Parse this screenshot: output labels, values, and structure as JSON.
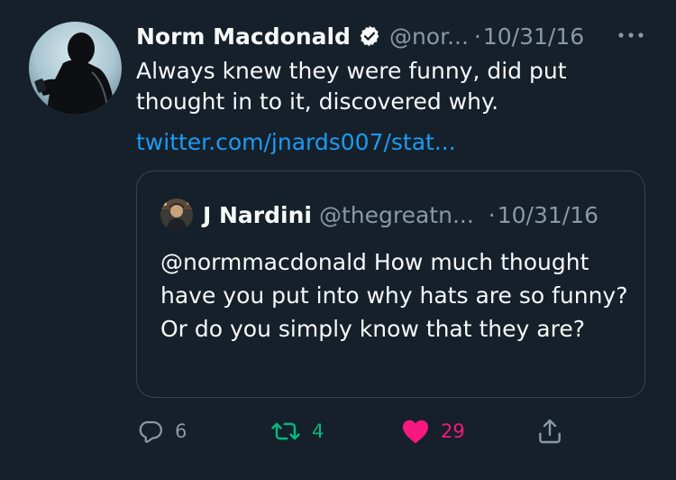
{
  "colors": {
    "background": "#15202b",
    "text": "#f7f9f9",
    "secondary": "#8b98a5",
    "link": "#1d9bf0",
    "retweet_active": "#00ba7c",
    "like_active": "#f91880",
    "border": "#38444d"
  },
  "tweet": {
    "author_name": "Norm Macdonald",
    "handle": "@nor...",
    "separator": "·",
    "date": "10/31/16",
    "text": "Always knew they were funny, did put thought in to it, discovered why.",
    "link": "twitter.com/jnards007/stat...",
    "icons": {
      "verified": "verified-badge-icon",
      "more": "more-options-icon"
    }
  },
  "quoted_tweet": {
    "author_name": "J Nardini",
    "handle": "@thegreatn...",
    "separator": "·",
    "date": "10/31/16",
    "text": "@normmacdonald How much thought have you put into why hats are so funny? Or do you simply know that they are?"
  },
  "actions": {
    "reply": {
      "icon": "reply-icon",
      "count": "6"
    },
    "retweet": {
      "icon": "retweet-icon",
      "count": "4",
      "active": true
    },
    "like": {
      "icon": "heart-icon",
      "count": "29",
      "active": true
    },
    "share": {
      "icon": "share-icon"
    }
  }
}
